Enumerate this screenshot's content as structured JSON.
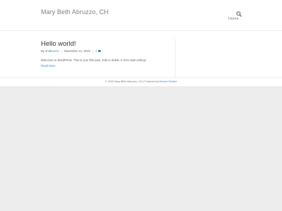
{
  "header": {
    "site_title": "Mary Beth Abruzzo, CH",
    "nav": {
      "home": "Home"
    },
    "search_icon": "search-icon"
  },
  "post": {
    "title": "Hello world!",
    "meta": {
      "by_label": "By",
      "author": "ahabruzzo",
      "date": "November 12, 2019",
      "comments_count": "1"
    },
    "excerpt": "Welcome to WordPress. This is your first post. Edit or delete it, then start writing!",
    "read_more": "Read More"
  },
  "footer": {
    "copyright": "© 2020 Mary Beth Abruzzo, CH | Powered by",
    "builder_link": "Beaver Builder"
  },
  "colors": {
    "link": "#3c8dbc",
    "text": "#666666",
    "title": "#808080",
    "background": "#ededed"
  }
}
